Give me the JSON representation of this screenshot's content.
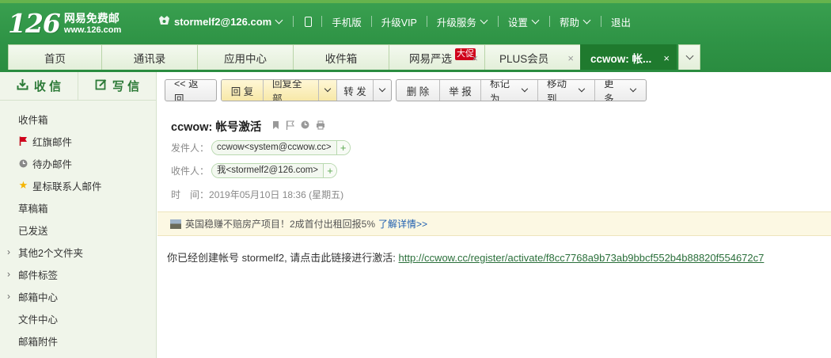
{
  "header": {
    "logo_num": "126",
    "logo_cn": "网易免费邮",
    "logo_url": "www.126.com",
    "user": "stormelf2@126.com",
    "nav": [
      "手机版",
      "升级VIP",
      "升级服务",
      "设置",
      "帮助",
      "退出"
    ]
  },
  "tabs": [
    {
      "label": "首页"
    },
    {
      "label": "通讯录"
    },
    {
      "label": "应用中心"
    },
    {
      "label": "收件箱"
    },
    {
      "label": "网易严选",
      "badge": "大促"
    },
    {
      "label": "PLUS会员"
    },
    {
      "label": "ccwow: 帐..."
    }
  ],
  "tab_close": "×",
  "sidebar": {
    "receive": "收 信",
    "compose": "写 信",
    "items": [
      {
        "label": "收件箱"
      },
      {
        "label": "红旗邮件"
      },
      {
        "label": "待办邮件"
      },
      {
        "label": "星标联系人邮件"
      },
      {
        "label": "草稿箱"
      },
      {
        "label": "已发送"
      },
      {
        "label": "其他2个文件夹"
      },
      {
        "label": "邮件标签"
      },
      {
        "label": "邮箱中心"
      },
      {
        "label": "文件中心"
      },
      {
        "label": "邮箱附件"
      }
    ]
  },
  "toolbar": {
    "back": "<< 返回",
    "reply": "回 复",
    "reply_all": "回复全部",
    "forward": "转 发",
    "delete": "删 除",
    "report": "举 报",
    "mark_as": "标记为",
    "move_to": "移动到",
    "more": "更 多"
  },
  "mail": {
    "subject": "ccwow: 帐号激活",
    "from_label": "发件人：",
    "from": "ccwow<system@ccwow.cc>",
    "to_label": "收件人：",
    "to": "我<stormelf2@126.com>",
    "time_label": "时　间：",
    "time": "2019年05月10日 18:36 (星期五)",
    "body_text": "你已经创建帐号 stormelf2, 请点击此链接进行激活: ",
    "link": "http://ccwow.cc/register/activate/f8cc7768a9b73ab9bbcf552b4b88820f554672c7"
  },
  "ad": {
    "text": "英国稳赚不赔房产项目！2成首付出租回报5%",
    "link": "了解详情>>"
  },
  "colors": {
    "brand_green": "#2f9446",
    "active_tab": "#1f7a2e",
    "link": "#2a6f3a",
    "flag_red": "#d0021b"
  }
}
